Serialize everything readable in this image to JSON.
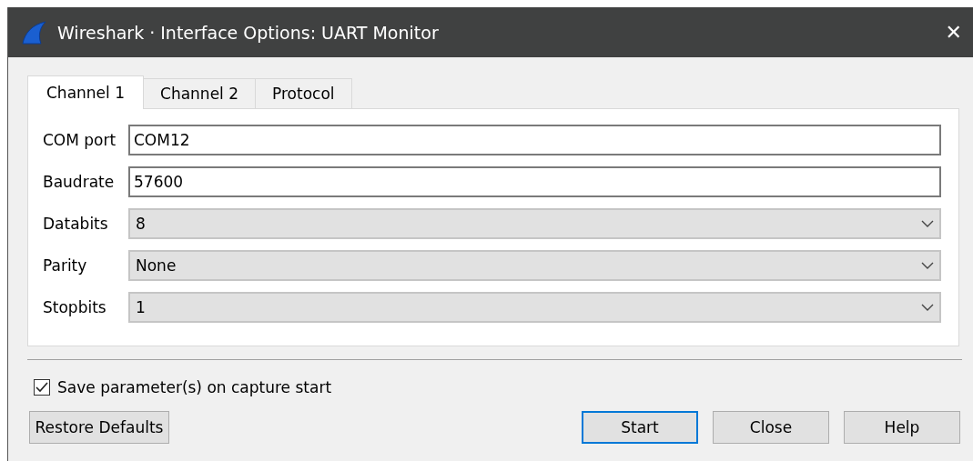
{
  "window": {
    "title": "Wireshark · Interface Options: UART Monitor",
    "close": "✕"
  },
  "tabs": [
    {
      "label": "Channel 1",
      "selected": true
    },
    {
      "label": "Channel 2",
      "selected": false
    },
    {
      "label": "Protocol",
      "selected": false
    }
  ],
  "fields": [
    {
      "kind": "text",
      "label": "COM port",
      "value": "COM12"
    },
    {
      "kind": "text",
      "label": "Baudrate",
      "value": "57600"
    },
    {
      "kind": "select",
      "label": "Databits",
      "value": "8"
    },
    {
      "kind": "select",
      "label": "Parity",
      "value": "None"
    },
    {
      "kind": "select",
      "label": "Stopbits",
      "value": "1"
    }
  ],
  "save_option": {
    "label": "Save parameter(s) on capture start",
    "checked": true
  },
  "restore_button": "Restore Defaults",
  "buttons": [
    {
      "label": "Start",
      "default": true
    },
    {
      "label": "Close",
      "default": false
    },
    {
      "label": "Help",
      "default": false
    }
  ]
}
